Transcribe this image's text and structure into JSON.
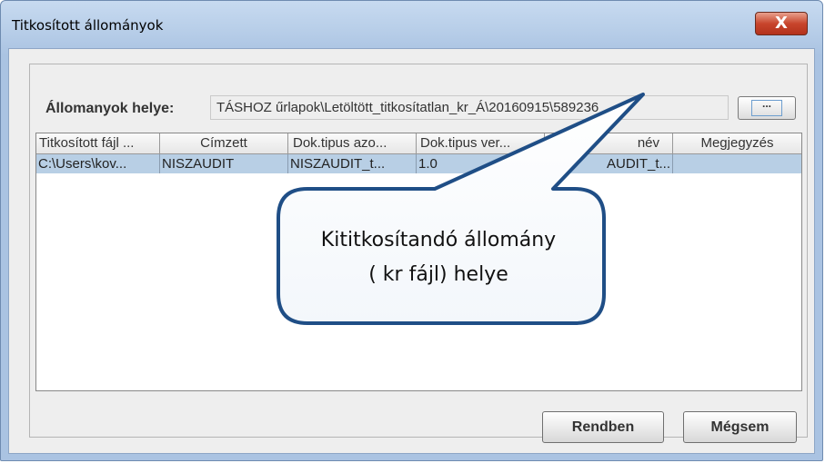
{
  "window": {
    "title": "Titkosított állományok",
    "close_symbol": "X"
  },
  "location": {
    "label": "Állomanyok helye:",
    "value": "TÁSHOZ űrlapok\\Letöltött_titkosítatlan_kr_Á\\20160915\\589236",
    "browse_label": "..."
  },
  "table": {
    "columns": [
      "Titkosított fájl ...",
      "Címzett",
      "Dok.tipus azo...",
      "Dok.tipus ver...",
      "név",
      "Megjegyzés"
    ],
    "rows": [
      [
        "C:\\Users\\kov...",
        "NISZAUDIT",
        "NISZAUDIT_t...",
        "1.0",
        "AUDIT_t...",
        ""
      ]
    ]
  },
  "buttons": {
    "ok": "Rendben",
    "cancel": "Mégsem"
  },
  "callout": {
    "line1": "Kititkosítandó állomány",
    "line2": "( kr fájl) helye"
  },
  "colors": {
    "selection": "#b8cfe5",
    "callout_border": "#1f4e86",
    "close_button": "#c8452c"
  },
  "icons": {
    "close": "close-icon",
    "browse": "ellipsis-icon"
  }
}
